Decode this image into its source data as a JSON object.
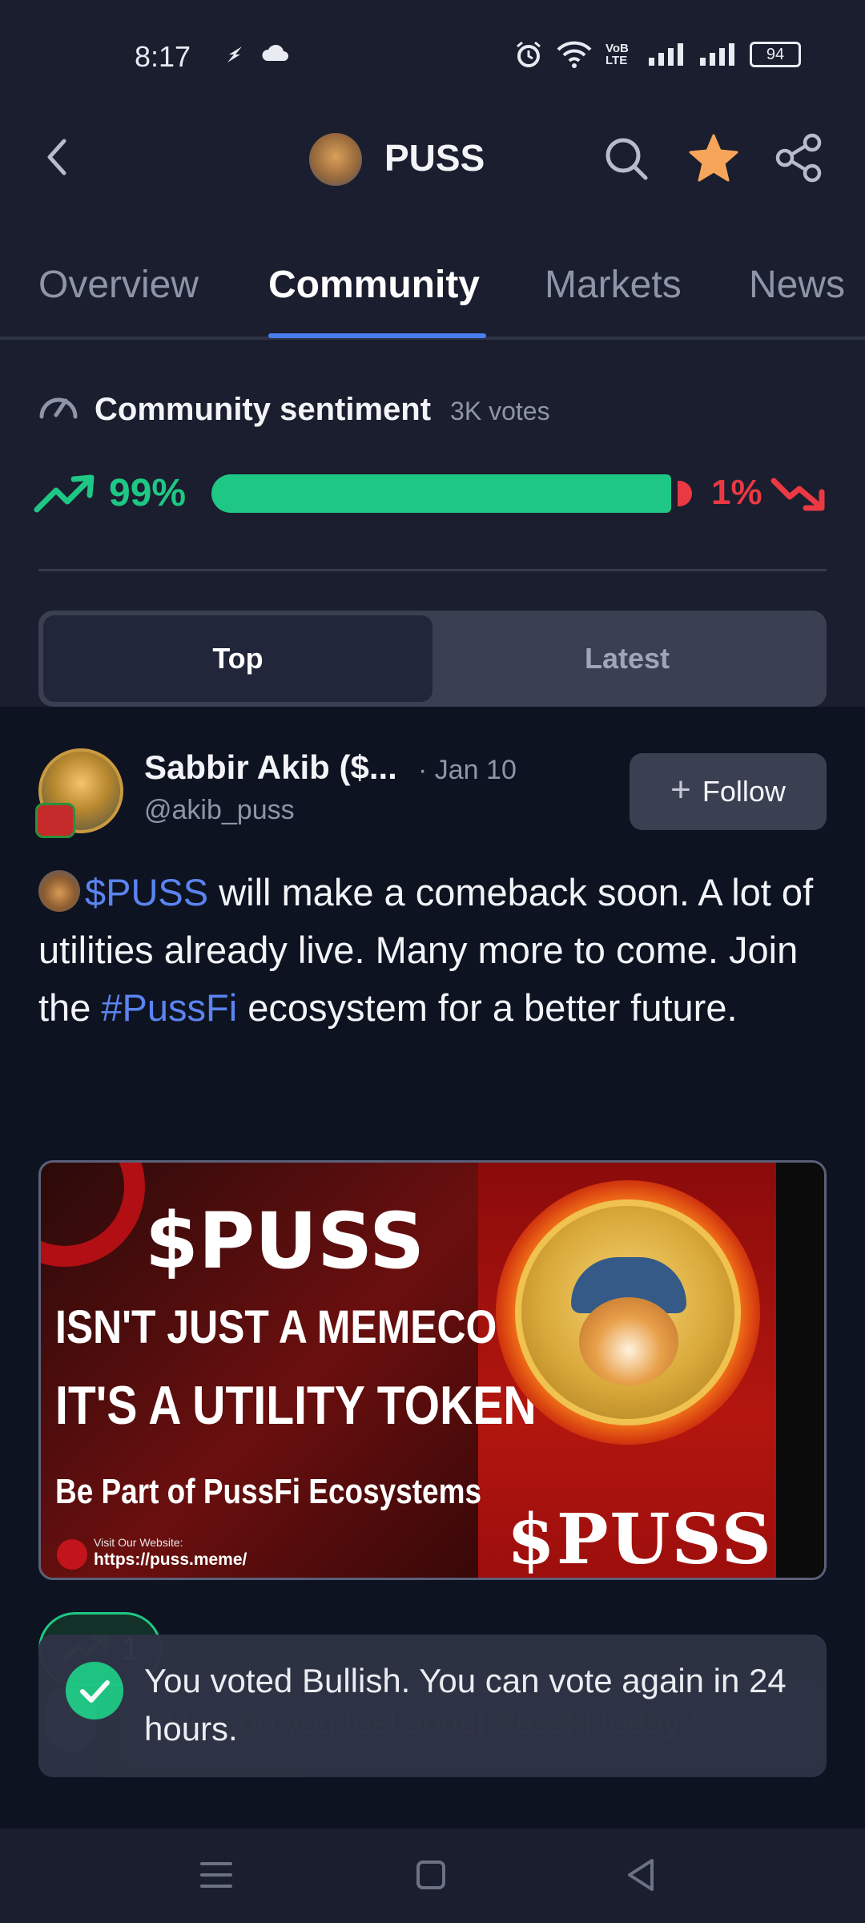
{
  "status_bar": {
    "time": "8:17",
    "network_label": "VoB LTE",
    "battery": "94"
  },
  "header": {
    "coin_name": "PUSS",
    "accent_star_color": "#f7a55a"
  },
  "tabs": [
    {
      "label": "Overview",
      "active": false
    },
    {
      "label": "Community",
      "active": true
    },
    {
      "label": "Markets",
      "active": false
    },
    {
      "label": "News",
      "active": false
    }
  ],
  "sentiment": {
    "title": "Community sentiment",
    "votes": "3K votes",
    "bullish_pct_label": "99%",
    "bearish_pct_label": "1%",
    "bullish_fraction": 0.99,
    "bull_color": "#1fc784",
    "bear_color": "#ea3943"
  },
  "feed_toggle": {
    "top_label": "Top",
    "latest_label": "Latest",
    "selected": "Top"
  },
  "post": {
    "author": "Sabbir Akib ($...",
    "date": "· Jan 10",
    "handle": "@akib_puss",
    "follow_label": "Follow",
    "text_cashtag": "$PUSS",
    "text_part1": " will make a comeback soon. A lot of utilities already live. Many more to come. Join the ",
    "text_hashtag": "#PussFi",
    "text_part2": " ecosystem for a better future.",
    "image": {
      "title": "$PUSS",
      "line1": "ISN'T JUST A MEMECOIN",
      "line2": "IT'S A UTILITY TOKEN",
      "line3": "Be Part of PussFi Ecosystems",
      "website_label": "Visit Our Website:",
      "website_url": "https://puss.meme/",
      "coin_text": "$PUSS"
    },
    "bullish_count": "1"
  },
  "composer": {
    "placeholder": "How do you feel about PussFi today?"
  },
  "toast": {
    "message": "You voted Bullish. You can vote again in 24 hours."
  }
}
